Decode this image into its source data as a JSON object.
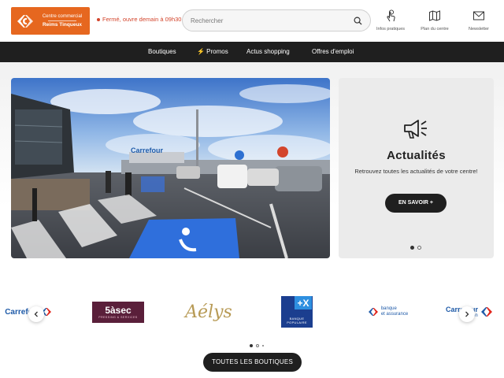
{
  "header": {
    "logo": {
      "subtitle": "Centre commercial",
      "name": "Reims Tinqueux"
    },
    "status": "Fermé, ouvre demain à 09h30",
    "search": {
      "placeholder": "Rechercher"
    },
    "nav": [
      {
        "label": "Infos pratiques",
        "icon": "hand-pointer-icon"
      },
      {
        "label": "Plan du centre",
        "icon": "map-icon"
      },
      {
        "label": "Newsletter",
        "icon": "envelope-icon"
      }
    ]
  },
  "navbar": {
    "items": [
      {
        "label": "Boutiques"
      },
      {
        "label": "⚡ Promos"
      },
      {
        "label": "Actus shopping"
      },
      {
        "label": "Offres d'emploi"
      }
    ]
  },
  "hero": {
    "image": "parking-photo",
    "store_sign": "Carrefour"
  },
  "news": {
    "title": "Actualités",
    "description": "Retrouvez toutes les actualités de votre centre!",
    "button": "EN SAVOIR +",
    "slides_total": 2,
    "slide_active": 1
  },
  "brands": {
    "items": [
      {
        "name": "Carrefour"
      },
      {
        "name": "5àsec",
        "tagline": "PRESSING & SERVICES"
      },
      {
        "name": "Aélys"
      },
      {
        "name": "BANQUE POPULAIRE"
      },
      {
        "name": "Carrefour banque et assurance",
        "line1": "banque",
        "line2": "et assurance"
      },
      {
        "name": "Carrefour Location",
        "line1": "Carrefour",
        "line2": "Location"
      }
    ],
    "pages_total": 3,
    "page_active": 1,
    "button": "TOUTES LES BOUTIQUES"
  },
  "colors": {
    "brand_orange": "#e6671f",
    "status_red": "#d3452c",
    "dark": "#1f1f1f",
    "carrefour_blue": "#1e5aa8",
    "carrefour_red": "#e1251b"
  }
}
